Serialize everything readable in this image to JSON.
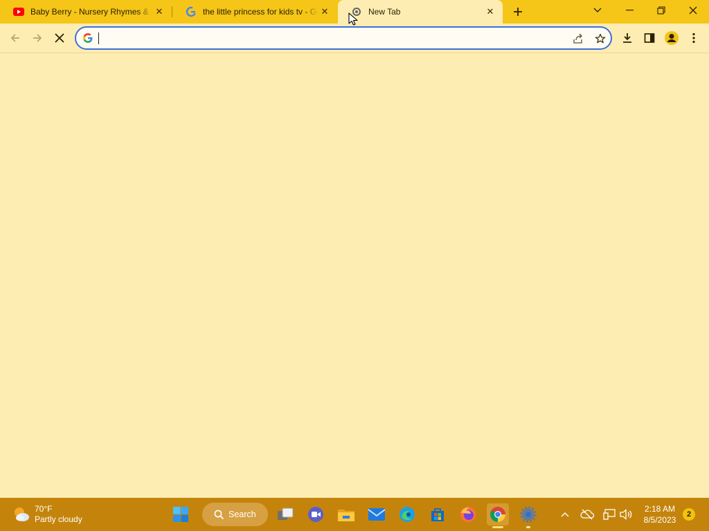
{
  "browser": {
    "tabs": [
      {
        "title": "Baby Berry - Nursery Rhymes & Kids Songs",
        "icon": "youtube-icon",
        "active": false
      },
      {
        "title": "the little princess for kids tv - Google Search",
        "icon": "google-icon",
        "active": false
      },
      {
        "title": "New Tab",
        "icon": "loading-icon",
        "active": true
      }
    ],
    "omnibox": {
      "value": "",
      "placeholder": ""
    },
    "theme": {
      "tab_strip": "#f5c518",
      "page_bg": "#fdedb2",
      "focus_ring": "#3c6fd8"
    }
  },
  "taskbar": {
    "weather": {
      "temp": "70°F",
      "condition": "Partly cloudy",
      "icon": "partly-cloudy-icon"
    },
    "search_label": "Search",
    "clock": {
      "time": "2:18 AM",
      "date": "8/5/2023"
    },
    "notification_count": "2",
    "pinned_apps": [
      "windows-start-icon",
      "search-icon",
      "task-view-icon",
      "teams-meet-icon",
      "file-explorer-icon",
      "mail-icon",
      "edge-icon",
      "microsoft-store-icon",
      "firefox-icon",
      "chrome-icon",
      "settings-icon"
    ],
    "color": "#c4840c"
  }
}
